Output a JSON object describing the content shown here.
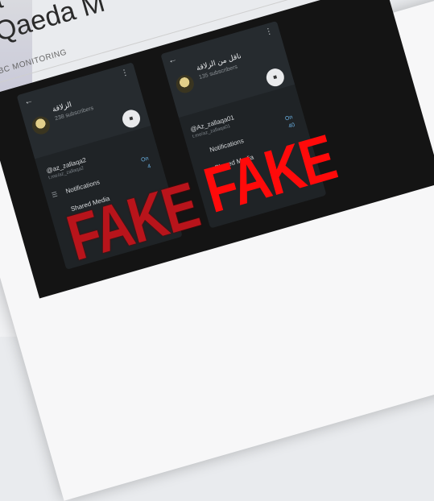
{
  "article": {
    "headline_line1": "w wa",
    "headline_line2": "r al-Qaeda M",
    "byline": "BY BBC MONITORING"
  },
  "phones": [
    {
      "channel_name": "الزلاقة",
      "subscribers": "238 subscribers",
      "username": "@az_zallaqa2",
      "link": "t.me/az_zallaqa2",
      "toggle_value": "On",
      "notifications_label": "Notifications",
      "notifications_value": "4",
      "shared_media_label": "Shared Media",
      "stamp": "FAKE"
    },
    {
      "channel_name": "ناقل من الزلاقة",
      "subscribers": "135 subscribers",
      "username": "@Az_zallaqa01",
      "link": "t.me/az_zallaqa01",
      "toggle_value": "On",
      "notifications_label": "Notifications",
      "notifications_value": "40",
      "shared_media_label": "Shared Media",
      "stamp": "FAKE"
    }
  ],
  "icons": {
    "back": "arrow-left-icon",
    "more": "more-vertical-icon",
    "fab": "message-icon",
    "notifications": "list-icon"
  }
}
